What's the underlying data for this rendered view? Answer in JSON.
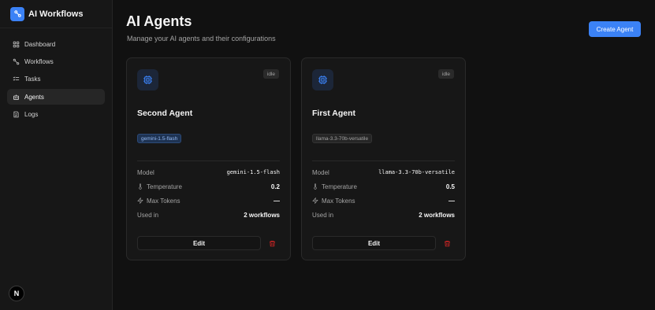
{
  "app": {
    "title": "AI Workflows",
    "logo_icon": "workflow-icon"
  },
  "sidebar": {
    "items": [
      {
        "label": "Dashboard",
        "icon": "dashboard-icon"
      },
      {
        "label": "Workflows",
        "icon": "workflows-icon"
      },
      {
        "label": "Tasks",
        "icon": "tasks-icon"
      },
      {
        "label": "Agents",
        "icon": "bot-icon",
        "active": true
      },
      {
        "label": "Logs",
        "icon": "logs-icon"
      }
    ],
    "avatar_letter": "N"
  },
  "header": {
    "title": "AI Agents",
    "subtitle": "Manage your AI agents and their configurations",
    "create_label": "Create Agent"
  },
  "labels": {
    "model": "Model",
    "temperature": "Temperature",
    "max_tokens": "Max Tokens",
    "used_in": "Used in",
    "edit": "Edit"
  },
  "agents": [
    {
      "name": "Second Agent",
      "status": "idle",
      "model_badge": "gemini-1.5-flash",
      "model": "gemini-1.5-flash",
      "temperature": "0.2",
      "max_tokens": "—",
      "used_in": "2 workflows"
    },
    {
      "name": "First Agent",
      "status": "idle",
      "model_badge": "llama-3.3-70b-versatile",
      "model": "llama-3.3-70b-versatile",
      "temperature": "0.5",
      "max_tokens": "—",
      "used_in": "2 workflows"
    }
  ],
  "colors": {
    "accent": "#3b82f6",
    "danger": "#dc2626",
    "background": "#111111"
  }
}
